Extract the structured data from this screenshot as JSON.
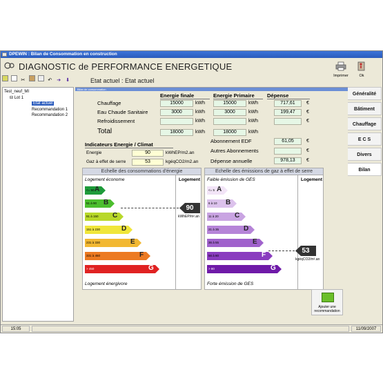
{
  "window": {
    "title": "DPEWIN : Bilan de Consommation en construction"
  },
  "header": {
    "main_title": "DIAGNOSTIC de PERFORMANCE ENERGETIQUE",
    "state": "Etat actuel  :  Etat actuel",
    "print_label": "Imprimer",
    "ok_label": "Ok"
  },
  "tree": {
    "root": "Test_neuf_MI",
    "lot": "Lot 1",
    "items": [
      "Etat actuel",
      "Recommandation 1",
      "Recommandation 2"
    ]
  },
  "content_header": "Bilan de consommation",
  "tabs": [
    "Généralité",
    "Bâtiment",
    "Chauffage",
    "E C S",
    "Divers",
    "Bilan"
  ],
  "energie_finale": {
    "header": "Energie finale",
    "chauffage": "15000",
    "ecs": "3000",
    "refroidissement": "",
    "total": "18000",
    "unit": "kWh"
  },
  "energie_primaire": {
    "header": "Energie Primaire",
    "chauffage": "15000",
    "ecs": "3000",
    "refroidissement": "",
    "total": "18000",
    "unit": "kWh"
  },
  "depense": {
    "header": "Dépense",
    "chauffage": "717,61",
    "ecs": "199,47",
    "refroidissement": "",
    "currency": "€",
    "abonnement_edf": "61,05",
    "autres": "",
    "annuelle": "978,13"
  },
  "row_labels": {
    "chauffage": "Chauffage",
    "ecs": "Eau Chaude Sanitaire",
    "refroidissement": "Refroidissement",
    "total": "Total",
    "abonnement_edf": "Abonnement EDF",
    "autres": "Autres Abonnements",
    "annuelle": "Dépense annuelle"
  },
  "indicateurs": {
    "title": "Indicateurs Energie / Climat",
    "energie_label": "Energie",
    "energie_value": "90",
    "energie_unit": "kWhEP/m2.an",
    "ges_label": "Gaz à effet de serre",
    "ges_value": "53",
    "ges_unit": "kgéqCO2/m2.an"
  },
  "energy_scale": {
    "title": "Echelle des consommations d'énergie",
    "col_label": "Logement",
    "top_text": "Logement économe",
    "bottom_text": "Logement énergivore",
    "marker_value": "90",
    "marker_unit": "kWhEP/m².an",
    "bars": [
      {
        "range": "<= 50",
        "letter": "A",
        "color": "#1e9b3a"
      },
      {
        "range": "51 à 90",
        "letter": "B",
        "color": "#4cbe2e"
      },
      {
        "range": "91 à 150",
        "letter": "C",
        "color": "#b8d82a"
      },
      {
        "range": "151 à 230",
        "letter": "D",
        "color": "#f0e63a"
      },
      {
        "range": "231 à 330",
        "letter": "E",
        "color": "#f2b832"
      },
      {
        "range": "331 à 450",
        "letter": "F",
        "color": "#ec7a22"
      },
      {
        "range": "> 450",
        "letter": "G",
        "color": "#e02222"
      }
    ]
  },
  "ges_scale": {
    "title": "Echelle des émissions de gaz à effet de serre",
    "col_label": "Logement",
    "top_text": "Faible émission de GES",
    "bottom_text": "Forte émission de GES",
    "marker_value": "53",
    "marker_unit": "kgéqCO2/m².an",
    "bars": [
      {
        "range": "<= 5",
        "letter": "A",
        "color": "#f2e4f7"
      },
      {
        "range": "6 à 10",
        "letter": "B",
        "color": "#dcc2ec"
      },
      {
        "range": "11 à 20",
        "letter": "C",
        "color": "#c9a4e2"
      },
      {
        "range": "21 à 35",
        "letter": "D",
        "color": "#b684d8"
      },
      {
        "range": "36 à 55",
        "letter": "E",
        "color": "#a062cc"
      },
      {
        "range": "56 à 80",
        "letter": "F",
        "color": "#8a3cbf"
      },
      {
        "range": "> 80",
        "letter": "G",
        "color": "#6f1aa8"
      }
    ]
  },
  "add_button": "Ajouter une recommandation",
  "status": {
    "time": "15:05",
    "date": "11/09/2007"
  }
}
